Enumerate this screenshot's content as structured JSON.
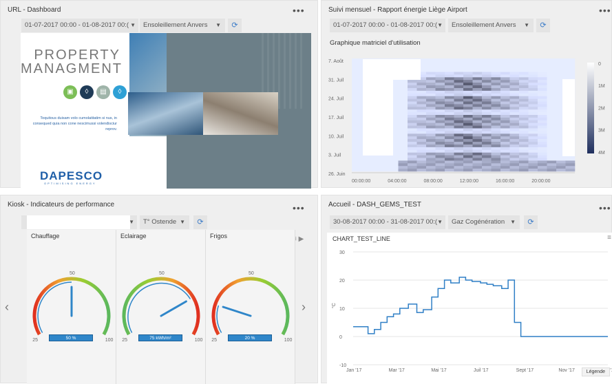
{
  "panels": {
    "url": {
      "title": "URL - Dashboard",
      "date_range": "01-07-2017 00:00 - 01-08-2017 00:(",
      "location": "Ensoleillement Anvers",
      "property": {
        "title_line1": "PROPERTY",
        "title_line2": "MANAGMENT",
        "body": "Toquitous duisam volo cumolatitatim si nus, in consequed quia non cone nescimussi volendisciur reprov.",
        "brand": "DAPESCO",
        "brand_sub": "OPTIMISING ENERGY"
      }
    },
    "monthly": {
      "title": "Suivi mensuel - Rapport énergie Liège Airport",
      "date_range": "01-07-2017 00:00 - 01-08-2017 00:(",
      "location": "Ensoleillement Anvers",
      "chart_title": "Graphique matriciel d'utilisation"
    },
    "kiosk": {
      "title": "Kiosk - Indicateurs de performance",
      "location": "T° Ostende",
      "gauges": [
        {
          "label": "Chauffage",
          "value_text": "50 %",
          "value": 50
        },
        {
          "label": "Eclairage",
          "value_text": "75 kWh/m²",
          "value": 75
        },
        {
          "label": "Frigos",
          "value_text": "20 %",
          "value": 20
        }
      ],
      "gauge_min": "25",
      "gauge_mid": "50",
      "gauge_max": "100"
    },
    "accueil": {
      "title": "Accueil - DASH_GEMS_TEST",
      "date_range": "30-08-2017 00:00 - 31-08-2017 00:(",
      "location": "Gaz Cogénération",
      "chart_title": "CHART_TEST_LINE",
      "legend_button": "Légende"
    }
  },
  "chart_data": [
    {
      "type": "heatmap",
      "title": "Graphique matriciel d'utilisation",
      "y_categories": [
        "7. Août",
        "31. Juil",
        "24. Juil",
        "17. Juil",
        "10. Juil",
        "3. Juil",
        "26. Juin"
      ],
      "x_categories": [
        "00:00:00",
        "04:00:00",
        "08:00:00",
        "12:00:00",
        "16:00:00",
        "20:00:00"
      ],
      "colorbar": [
        "0",
        "1M",
        "2M",
        "3M",
        "4M"
      ]
    },
    {
      "type": "line",
      "title": "CHART_TEST_LINE",
      "xlabel": "",
      "ylabel": "°C",
      "ylim": [
        -10,
        30
      ],
      "yticks": [
        "-10",
        "0",
        "10",
        "20",
        "30"
      ],
      "xticks": [
        "Jan '17",
        "Mar '17",
        "Mai '17",
        "Juil '17",
        "Sept '17",
        "Nov '17",
        "Jan '18"
      ],
      "x": [
        0,
        0.7,
        0.7,
        1.0,
        1.0,
        1.3,
        1.3,
        1.6,
        1.6,
        1.9,
        1.9,
        2.2,
        2.2,
        2.6,
        2.6,
        3.0,
        3.0,
        3.3,
        3.3,
        3.7,
        3.7,
        4.0,
        4.0,
        4.3,
        4.3,
        4.6,
        4.6,
        5.0,
        5.0,
        5.3,
        5.3,
        5.6,
        5.6,
        6.0,
        6.0,
        6.3,
        6.3,
        6.6,
        6.6,
        7.0,
        7.0,
        7.3,
        7.3,
        7.6,
        7.6,
        7.9,
        7.9,
        8.2,
        8.2,
        8.4,
        8.4,
        12.0
      ],
      "values": [
        3.5,
        3.5,
        1,
        1,
        2.5,
        2.5,
        5,
        5,
        7,
        7,
        8,
        8,
        10,
        10,
        11.5,
        11.5,
        8.5,
        8.5,
        9.5,
        9.5,
        14,
        14,
        17,
        17,
        20,
        20,
        19,
        19,
        21,
        21,
        20,
        20,
        19.5,
        19.5,
        19,
        19,
        18.5,
        18.5,
        18,
        18,
        17,
        17,
        20,
        20,
        5,
        5,
        0,
        0,
        0,
        0,
        0,
        0
      ],
      "series": [
        {
          "name": "",
          "color": "#2f7fc6"
        }
      ]
    }
  ],
  "colors": {
    "accent": "#3a7bc8",
    "gauge_value": "#2f86c9"
  }
}
